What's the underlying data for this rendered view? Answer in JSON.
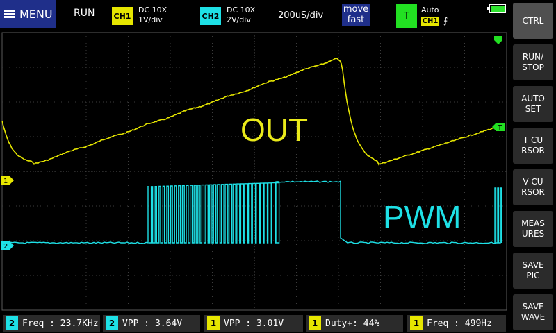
{
  "top": {
    "menu_label": "MENU",
    "run_state": "RUN",
    "ch1": {
      "tag": "CH1",
      "coupling": "DC  10X",
      "scale": "1V/div"
    },
    "ch2": {
      "tag": "CH2",
      "coupling": "DC  10X",
      "scale": "2V/div"
    },
    "timebase": "200uS/div",
    "mode_line1": "move",
    "mode_line2": "fast",
    "trigger": {
      "tag": "T",
      "mode": "Auto",
      "source": "CH1",
      "edge": "⨍"
    }
  },
  "side_buttons": [
    {
      "label": "CTRL"
    },
    {
      "label": "RUN/\nSTOP"
    },
    {
      "label": "AUTO\nSET"
    },
    {
      "label": "T CU\nRSOR"
    },
    {
      "label": "V CU\nRSOR"
    },
    {
      "label": "MEAS\nURES"
    },
    {
      "label": "SAVE\nPIC"
    },
    {
      "label": "SAVE\nWAVE"
    }
  ],
  "screen": {
    "out_label": "OUT",
    "pwm_label": "PWM",
    "ch1_marker": "1",
    "ch2_marker": "2",
    "trigger_marker": "T"
  },
  "measurements": [
    {
      "channel": "2",
      "text": "Freq : 23.7KHz"
    },
    {
      "channel": "2",
      "text": "VPP : 3.64V"
    },
    {
      "channel": "1",
      "text": "VPP : 3.01V"
    },
    {
      "channel": "1",
      "text": "Duty+: 44%"
    },
    {
      "channel": "1",
      "text": "Freq : 499Hz"
    }
  ],
  "colors": {
    "ch1": "#e6e600",
    "ch2": "#1ee0e6",
    "trigger": "#22e022",
    "menu": "#1f2f8a"
  },
  "icons": {
    "menu": "hamburger-icon",
    "battery": "battery-icon",
    "trigger_edge": "rising-edge-icon"
  }
}
